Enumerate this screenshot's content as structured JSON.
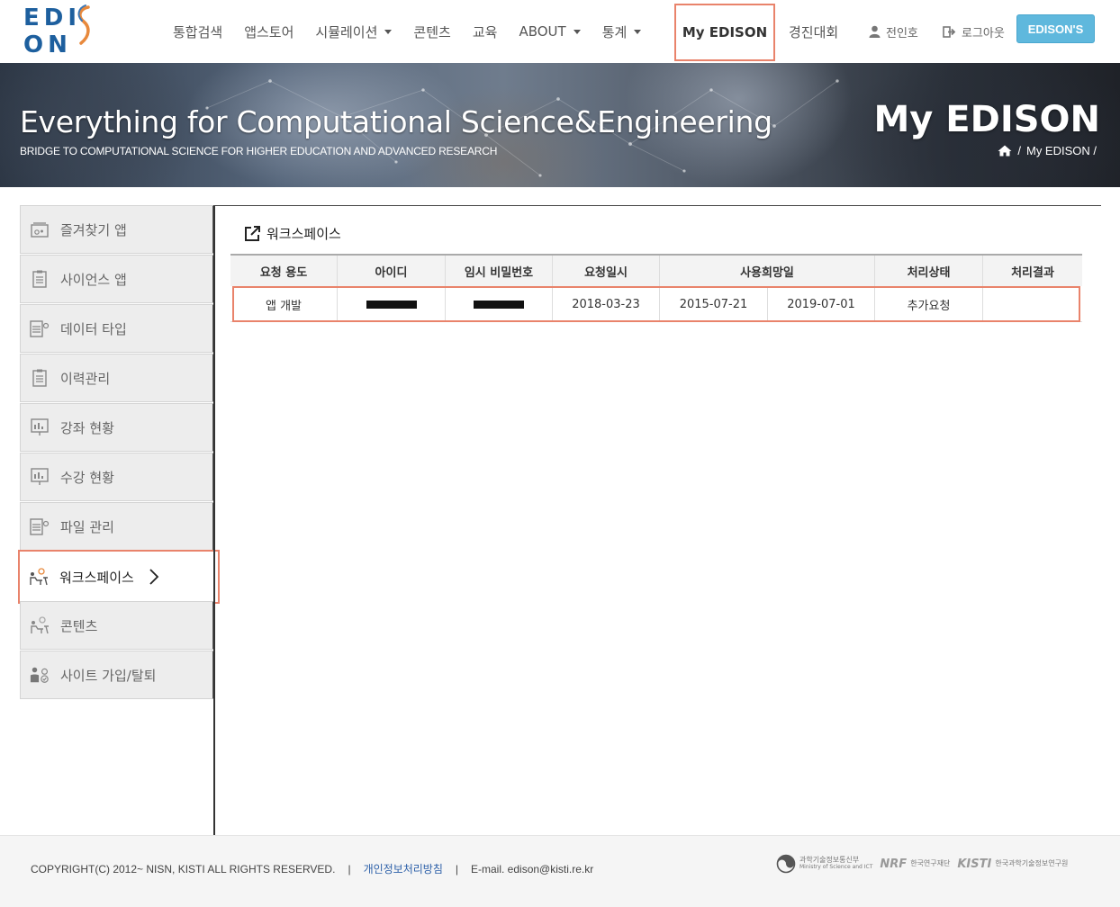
{
  "logo": {
    "text": "EDISON",
    "left": "EDI",
    "right": "ON"
  },
  "nav": {
    "items": [
      {
        "label": "통합검색",
        "dropdown": false
      },
      {
        "label": "앱스토어",
        "dropdown": false
      },
      {
        "label": "시뮬레이션",
        "dropdown": true
      },
      {
        "label": "콘텐츠",
        "dropdown": false
      },
      {
        "label": "교육",
        "dropdown": false
      },
      {
        "label": "ABOUT",
        "dropdown": true
      },
      {
        "label": "통계",
        "dropdown": true
      }
    ],
    "active": "My EDISON",
    "contest": "경진대회",
    "user": "전인호",
    "logout": "로그아웃",
    "edisons": "EDISON'S"
  },
  "banner": {
    "title": "Everything for Computational Science&Engineering",
    "subtitle": "BRIDGE TO COMPUTATIONAL SCIENCE FOR HIGHER EDUCATION AND ADVANCED RESEARCH",
    "page_title": "My EDISON",
    "breadcrumb": "My EDISON /",
    "breadcrumb_sep": "/"
  },
  "sidebar": {
    "items": [
      {
        "label": "즐겨찾기 앱",
        "icon": "bookmark-app-icon"
      },
      {
        "label": "사이언스 앱",
        "icon": "document-icon"
      },
      {
        "label": "데이터 타입",
        "icon": "data-type-icon"
      },
      {
        "label": "이력관리",
        "icon": "document-icon"
      },
      {
        "label": "강좌 현황",
        "icon": "chart-icon"
      },
      {
        "label": "수강 현황",
        "icon": "chart-icon"
      },
      {
        "label": "파일 관리",
        "icon": "file-manage-icon"
      },
      {
        "label": "워크스페이스",
        "icon": "workspace-icon",
        "active": true
      },
      {
        "label": "콘텐츠",
        "icon": "workspace-icon"
      },
      {
        "label": "사이트 가입/탈퇴",
        "icon": "user-join-icon"
      }
    ]
  },
  "main": {
    "title": "워크스페이스",
    "table": {
      "headers": [
        "요청 용도",
        "아이디",
        "임시 비밀번호",
        "요청일시",
        "사용희망일",
        "처리상태",
        "처리결과"
      ],
      "rows": [
        {
          "purpose": "앱 개발",
          "id": "",
          "temp_password": "",
          "request_date": "2018-03-23",
          "use_start": "2015-07-21",
          "use_end": "2019-07-01",
          "status": "추가요청",
          "result": ""
        }
      ]
    }
  },
  "footer": {
    "copyright": "COPYRIGHT(C) 2012~ NISN, KISTI ALL RIGHTS RESERVED.",
    "privacy": "개인정보처리방침",
    "email": "E-mail. edison@kisti.re.kr",
    "orgs": [
      {
        "abbr": "",
        "name": "과학기술정보통신부",
        "sub": "Ministry of Science and ICT"
      },
      {
        "abbr": "NRF",
        "name": "한국연구재단",
        "sub": ""
      },
      {
        "abbr": "KISTI",
        "name": "한국과학기술정보연구원",
        "sub": ""
      }
    ]
  },
  "colors": {
    "highlight": "#e9836b",
    "brand": "#1d5f9e",
    "button": "#5fb8dd",
    "link": "#2b5fa8"
  }
}
